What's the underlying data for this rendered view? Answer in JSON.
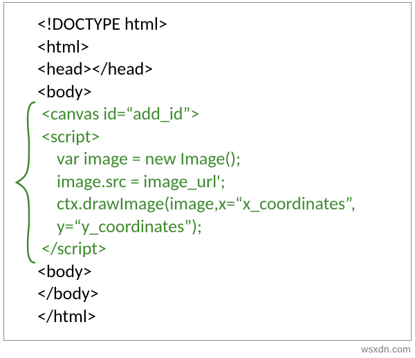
{
  "code": {
    "line1": "<!DOCTYPE html>",
    "line2": "<html>",
    "line3": "<head></head>",
    "line4": "<body>",
    "line5": "<canvas id=“add_id”>",
    "line6": "<script>",
    "line7": "var image = new Image();",
    "line8": "image.src = image_url';",
    "line9": "ctx.drawImage(image,x=“x_coordinates”,",
    "line10": "y=“y_coordinates”);",
    "line11": "</script>",
    "line12": "<body>",
    "line13": "</body>",
    "line14": "</html>"
  },
  "watermark": "wsxdn.com"
}
